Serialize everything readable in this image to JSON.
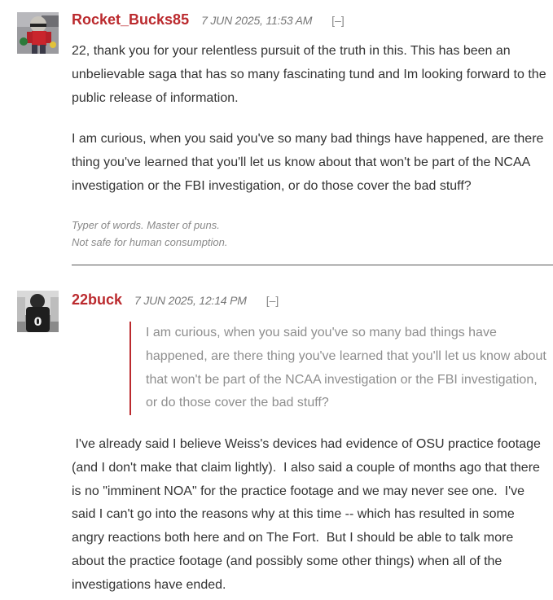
{
  "comments": [
    {
      "username": "Rocket_Bucks85",
      "timestamp": "7 JUN 2025, 11:53 AM",
      "collapse": "[–]",
      "paragraphs": [
        "22, thank you for your relentless pursuit of the truth in this. This has been an unbelievable saga that has so many fascinating tund and Im looking forward to the public release of information.",
        "I am curious, when you said you've so many bad things have happened, are there thing you've learned that you'll let us know about that won't be part of the NCAA investigation or the FBI investigation, or do those cover the bad stuff?"
      ],
      "signature": [
        "Typer of words. Master of puns.",
        "Not safe for human consumption."
      ]
    },
    {
      "username": "22buck",
      "timestamp": "7 JUN 2025, 12:14 PM",
      "collapse": "[–]",
      "quote": "I am curious, when you said you've so many bad things have happened, are there thing you've learned that you'll let us know about that won't be part of the NCAA investigation or the FBI investigation, or do those cover the bad stuff?",
      "paragraphs": [
        " I've already said I believe Weiss's devices had evidence of OSU practice footage (and I don't make that claim lightly).  I also said a couple of months ago that there is no \"imminent NOA\" for the practice footage and we may never see one.  I've said I can't go into the reasons why at this time -- which has resulted in some angry reactions both here and on The Fort.  But I should be able to talk more about the practice footage (and possibly some other things) when all of the investigations have ended."
      ]
    }
  ]
}
